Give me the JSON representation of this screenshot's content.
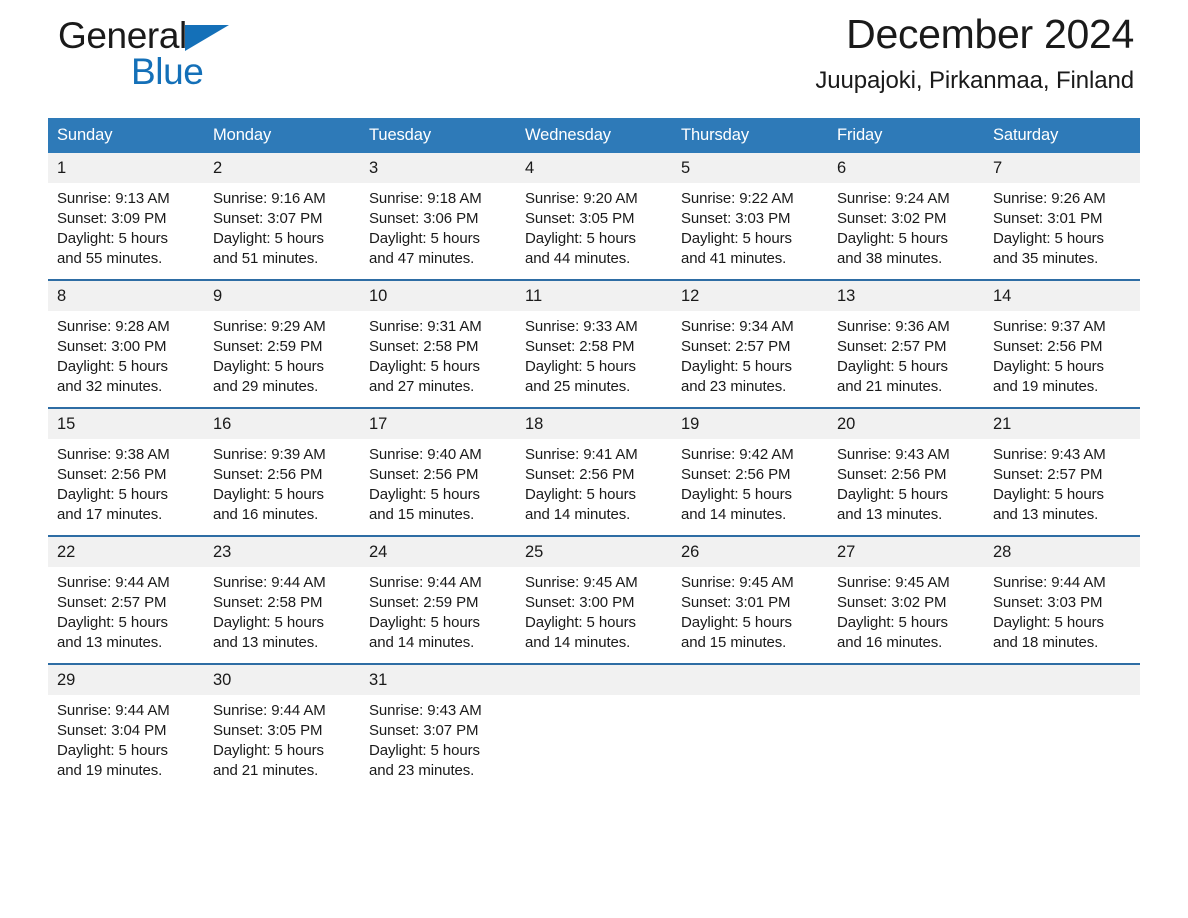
{
  "brand": {
    "name_part1": "General",
    "name_part2": "Blue",
    "triangle_color": "#1470b8"
  },
  "header": {
    "title": "December 2024",
    "subtitle": "Juupajoki, Pirkanmaa, Finland",
    "header_bg_color": "#2e7ab8",
    "row_divider_color": "#2e6da4",
    "daynum_bg_color": "#f1f1f1"
  },
  "weekdays": [
    "Sunday",
    "Monday",
    "Tuesday",
    "Wednesday",
    "Thursday",
    "Friday",
    "Saturday"
  ],
  "weeks": [
    [
      {
        "day": "1",
        "sunrise": "Sunrise: 9:13 AM",
        "sunset": "Sunset: 3:09 PM",
        "daylight1": "Daylight: 5 hours",
        "daylight2": "and 55 minutes."
      },
      {
        "day": "2",
        "sunrise": "Sunrise: 9:16 AM",
        "sunset": "Sunset: 3:07 PM",
        "daylight1": "Daylight: 5 hours",
        "daylight2": "and 51 minutes."
      },
      {
        "day": "3",
        "sunrise": "Sunrise: 9:18 AM",
        "sunset": "Sunset: 3:06 PM",
        "daylight1": "Daylight: 5 hours",
        "daylight2": "and 47 minutes."
      },
      {
        "day": "4",
        "sunrise": "Sunrise: 9:20 AM",
        "sunset": "Sunset: 3:05 PM",
        "daylight1": "Daylight: 5 hours",
        "daylight2": "and 44 minutes."
      },
      {
        "day": "5",
        "sunrise": "Sunrise: 9:22 AM",
        "sunset": "Sunset: 3:03 PM",
        "daylight1": "Daylight: 5 hours",
        "daylight2": "and 41 minutes."
      },
      {
        "day": "6",
        "sunrise": "Sunrise: 9:24 AM",
        "sunset": "Sunset: 3:02 PM",
        "daylight1": "Daylight: 5 hours",
        "daylight2": "and 38 minutes."
      },
      {
        "day": "7",
        "sunrise": "Sunrise: 9:26 AM",
        "sunset": "Sunset: 3:01 PM",
        "daylight1": "Daylight: 5 hours",
        "daylight2": "and 35 minutes."
      }
    ],
    [
      {
        "day": "8",
        "sunrise": "Sunrise: 9:28 AM",
        "sunset": "Sunset: 3:00 PM",
        "daylight1": "Daylight: 5 hours",
        "daylight2": "and 32 minutes."
      },
      {
        "day": "9",
        "sunrise": "Sunrise: 9:29 AM",
        "sunset": "Sunset: 2:59 PM",
        "daylight1": "Daylight: 5 hours",
        "daylight2": "and 29 minutes."
      },
      {
        "day": "10",
        "sunrise": "Sunrise: 9:31 AM",
        "sunset": "Sunset: 2:58 PM",
        "daylight1": "Daylight: 5 hours",
        "daylight2": "and 27 minutes."
      },
      {
        "day": "11",
        "sunrise": "Sunrise: 9:33 AM",
        "sunset": "Sunset: 2:58 PM",
        "daylight1": "Daylight: 5 hours",
        "daylight2": "and 25 minutes."
      },
      {
        "day": "12",
        "sunrise": "Sunrise: 9:34 AM",
        "sunset": "Sunset: 2:57 PM",
        "daylight1": "Daylight: 5 hours",
        "daylight2": "and 23 minutes."
      },
      {
        "day": "13",
        "sunrise": "Sunrise: 9:36 AM",
        "sunset": "Sunset: 2:57 PM",
        "daylight1": "Daylight: 5 hours",
        "daylight2": "and 21 minutes."
      },
      {
        "day": "14",
        "sunrise": "Sunrise: 9:37 AM",
        "sunset": "Sunset: 2:56 PM",
        "daylight1": "Daylight: 5 hours",
        "daylight2": "and 19 minutes."
      }
    ],
    [
      {
        "day": "15",
        "sunrise": "Sunrise: 9:38 AM",
        "sunset": "Sunset: 2:56 PM",
        "daylight1": "Daylight: 5 hours",
        "daylight2": "and 17 minutes."
      },
      {
        "day": "16",
        "sunrise": "Sunrise: 9:39 AM",
        "sunset": "Sunset: 2:56 PM",
        "daylight1": "Daylight: 5 hours",
        "daylight2": "and 16 minutes."
      },
      {
        "day": "17",
        "sunrise": "Sunrise: 9:40 AM",
        "sunset": "Sunset: 2:56 PM",
        "daylight1": "Daylight: 5 hours",
        "daylight2": "and 15 minutes."
      },
      {
        "day": "18",
        "sunrise": "Sunrise: 9:41 AM",
        "sunset": "Sunset: 2:56 PM",
        "daylight1": "Daylight: 5 hours",
        "daylight2": "and 14 minutes."
      },
      {
        "day": "19",
        "sunrise": "Sunrise: 9:42 AM",
        "sunset": "Sunset: 2:56 PM",
        "daylight1": "Daylight: 5 hours",
        "daylight2": "and 14 minutes."
      },
      {
        "day": "20",
        "sunrise": "Sunrise: 9:43 AM",
        "sunset": "Sunset: 2:56 PM",
        "daylight1": "Daylight: 5 hours",
        "daylight2": "and 13 minutes."
      },
      {
        "day": "21",
        "sunrise": "Sunrise: 9:43 AM",
        "sunset": "Sunset: 2:57 PM",
        "daylight1": "Daylight: 5 hours",
        "daylight2": "and 13 minutes."
      }
    ],
    [
      {
        "day": "22",
        "sunrise": "Sunrise: 9:44 AM",
        "sunset": "Sunset: 2:57 PM",
        "daylight1": "Daylight: 5 hours",
        "daylight2": "and 13 minutes."
      },
      {
        "day": "23",
        "sunrise": "Sunrise: 9:44 AM",
        "sunset": "Sunset: 2:58 PM",
        "daylight1": "Daylight: 5 hours",
        "daylight2": "and 13 minutes."
      },
      {
        "day": "24",
        "sunrise": "Sunrise: 9:44 AM",
        "sunset": "Sunset: 2:59 PM",
        "daylight1": "Daylight: 5 hours",
        "daylight2": "and 14 minutes."
      },
      {
        "day": "25",
        "sunrise": "Sunrise: 9:45 AM",
        "sunset": "Sunset: 3:00 PM",
        "daylight1": "Daylight: 5 hours",
        "daylight2": "and 14 minutes."
      },
      {
        "day": "26",
        "sunrise": "Sunrise: 9:45 AM",
        "sunset": "Sunset: 3:01 PM",
        "daylight1": "Daylight: 5 hours",
        "daylight2": "and 15 minutes."
      },
      {
        "day": "27",
        "sunrise": "Sunrise: 9:45 AM",
        "sunset": "Sunset: 3:02 PM",
        "daylight1": "Daylight: 5 hours",
        "daylight2": "and 16 minutes."
      },
      {
        "day": "28",
        "sunrise": "Sunrise: 9:44 AM",
        "sunset": "Sunset: 3:03 PM",
        "daylight1": "Daylight: 5 hours",
        "daylight2": "and 18 minutes."
      }
    ],
    [
      {
        "day": "29",
        "sunrise": "Sunrise: 9:44 AM",
        "sunset": "Sunset: 3:04 PM",
        "daylight1": "Daylight: 5 hours",
        "daylight2": "and 19 minutes."
      },
      {
        "day": "30",
        "sunrise": "Sunrise: 9:44 AM",
        "sunset": "Sunset: 3:05 PM",
        "daylight1": "Daylight: 5 hours",
        "daylight2": "and 21 minutes."
      },
      {
        "day": "31",
        "sunrise": "Sunrise: 9:43 AM",
        "sunset": "Sunset: 3:07 PM",
        "daylight1": "Daylight: 5 hours",
        "daylight2": "and 23 minutes."
      },
      {
        "day": "",
        "sunrise": "",
        "sunset": "",
        "daylight1": "",
        "daylight2": ""
      },
      {
        "day": "",
        "sunrise": "",
        "sunset": "",
        "daylight1": "",
        "daylight2": ""
      },
      {
        "day": "",
        "sunrise": "",
        "sunset": "",
        "daylight1": "",
        "daylight2": ""
      },
      {
        "day": "",
        "sunrise": "",
        "sunset": "",
        "daylight1": "",
        "daylight2": ""
      }
    ]
  ]
}
